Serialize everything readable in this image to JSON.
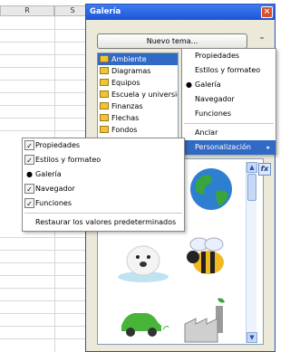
{
  "sheet": {
    "columns": [
      "R",
      "S"
    ]
  },
  "gallery": {
    "title": "Galería",
    "new_theme_button": "Nuevo tema...",
    "themes": [
      "Ambiente",
      "Diagramas",
      "Equipos",
      "Escuela y universidad",
      "Finanzas",
      "Flechas",
      "Fondos"
    ],
    "selected_theme": "Ambiente"
  },
  "gallery_menu": {
    "items": [
      {
        "label": "Propiedades",
        "marker": "none"
      },
      {
        "label": "Estilos y formateo",
        "marker": "none"
      },
      {
        "label": "Galería",
        "marker": "bullet"
      },
      {
        "label": "Navegador",
        "marker": "none"
      },
      {
        "label": "Funciones",
        "marker": "none"
      },
      {
        "label": "Anclar",
        "marker": "none"
      },
      {
        "label": "Personalización",
        "marker": "submenu"
      }
    ]
  },
  "customize_menu": {
    "items": [
      {
        "label": "Propiedades",
        "marker": "check"
      },
      {
        "label": "Estilos y formateo",
        "marker": "check"
      },
      {
        "label": "Galería",
        "marker": "bullet"
      },
      {
        "label": "Navegador",
        "marker": "check"
      },
      {
        "label": "Funciones",
        "marker": "check"
      }
    ],
    "restore_label": "Restaurar los valores predeterminados"
  },
  "colors": {
    "title_bar": "#1e55d6",
    "highlight": "#316ac5",
    "window_bg": "#ece9d8"
  },
  "icons": {
    "close": "close-icon",
    "options": "options-icon",
    "fx": "functions-icon"
  },
  "fx_label": "fx"
}
